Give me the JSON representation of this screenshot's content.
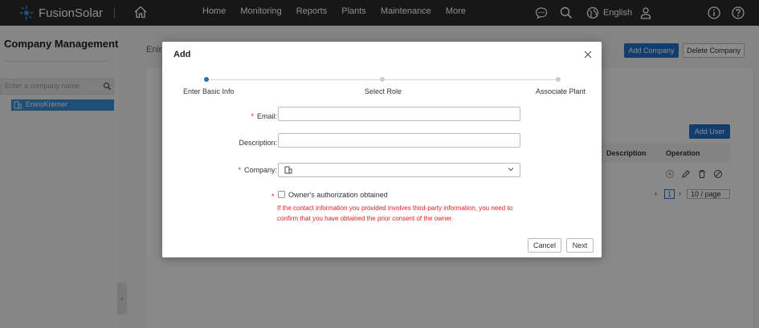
{
  "app": {
    "name": "FusionSolar"
  },
  "nav": {
    "items": [
      "Home",
      "Monitoring",
      "Reports",
      "Plants",
      "Maintenance",
      "More"
    ]
  },
  "topbar": {
    "language": "English"
  },
  "sidebar": {
    "title": "Company Management",
    "search_placeholder": "Enter a company name.",
    "items": [
      {
        "label": "EnirisKremer"
      }
    ]
  },
  "main": {
    "title_partial": "Enir",
    "add_company": "Add Company",
    "delete_company": "Delete Company",
    "add_user": "Add User",
    "columns": {
      "description": "Description",
      "operation": "Operation"
    },
    "pager": {
      "current_page": "1",
      "page_size": "10 / page"
    }
  },
  "modal": {
    "title": "Add",
    "steps": [
      "Enter Basic Info",
      "Select Role",
      "Associate Plant"
    ],
    "active_step": 0,
    "fields": {
      "email_label": "Email:",
      "description_label": "Description:",
      "company_label": "Company:"
    },
    "authorization_label": "Owner's authorization obtained",
    "warning": "If the contact information you provided involves third-party information, you need to confirm that you have obtained the prior consent of the owner.",
    "cancel": "Cancel",
    "next": "Next"
  },
  "colors": {
    "primary": "#1f72c8",
    "required": "#e02020",
    "topbar": "#2b2b2b"
  }
}
